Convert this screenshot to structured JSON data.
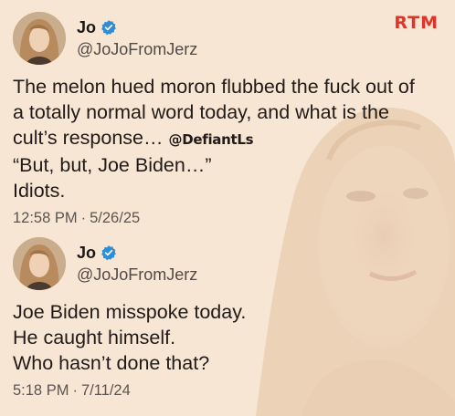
{
  "brand": {
    "logo_text": "RTM",
    "logo_color": "#e0342b"
  },
  "colors": {
    "background": "#f8e6d4",
    "verified_badge": "#2f8dd8",
    "text": "#201b18",
    "meta": "#5b5450"
  },
  "tweets": [
    {
      "author": {
        "name": "Jo",
        "handle": "@JoJoFromJerz",
        "verified_icon": "verified-badge-icon"
      },
      "lines": [
        "The melon hued moron flubbed the fuck out of",
        "a totally normal word today, and what is the",
        "cult’s response…",
        "“But, but, Joe Biden…”",
        "Idiots."
      ],
      "watermark_tag": "@DefiantLs",
      "time": "12:58 PM",
      "separator": "·",
      "date": "5/26/25"
    },
    {
      "author": {
        "name": "Jo",
        "handle": "@JoJoFromJerz",
        "verified_icon": "verified-badge-icon"
      },
      "lines": [
        "Joe Biden misspoke today.",
        "He caught himself.",
        "Who hasn’t done that?"
      ],
      "time": "5:18 PM",
      "separator": "·",
      "date": "7/11/24"
    }
  ]
}
